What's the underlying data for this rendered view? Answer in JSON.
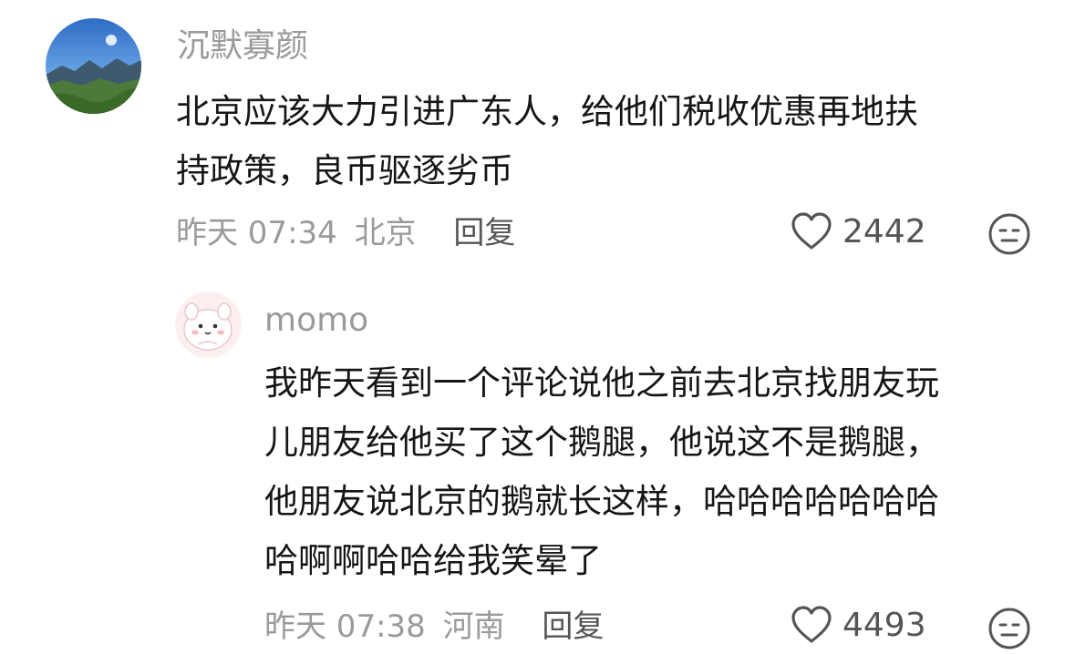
{
  "comments": [
    {
      "username": "沉默寡颜",
      "content_lines": [
        "北京应该大力引进广东人，给他们税收优惠再地扶",
        "持政策，良币驱逐劣币"
      ],
      "time": "昨天 07:34",
      "location": "北京",
      "reply_label": "回复",
      "likes": "2442",
      "avatar_icon": "landscape-avatar"
    },
    {
      "username": "momo",
      "content_lines": [
        "我昨天看到一个评论说他之前去北京找朋友玩",
        "儿朋友给他买了这个鹅腿，他说这不是鹅腿，",
        "他朋友说北京的鹅就长这样，哈哈哈哈哈哈哈",
        "哈啊啊哈哈给我笑晕了"
      ],
      "time": "昨天 07:38",
      "location": "河南",
      "reply_label": "回复",
      "likes": "4493",
      "avatar_icon": "cartoon-avatar"
    }
  ],
  "icons": {
    "like": "heart-outline-icon",
    "dislike": "neutral-face-icon"
  },
  "colors": {
    "text": "#161616",
    "muted": "#9a9a9a",
    "action": "#555555"
  }
}
